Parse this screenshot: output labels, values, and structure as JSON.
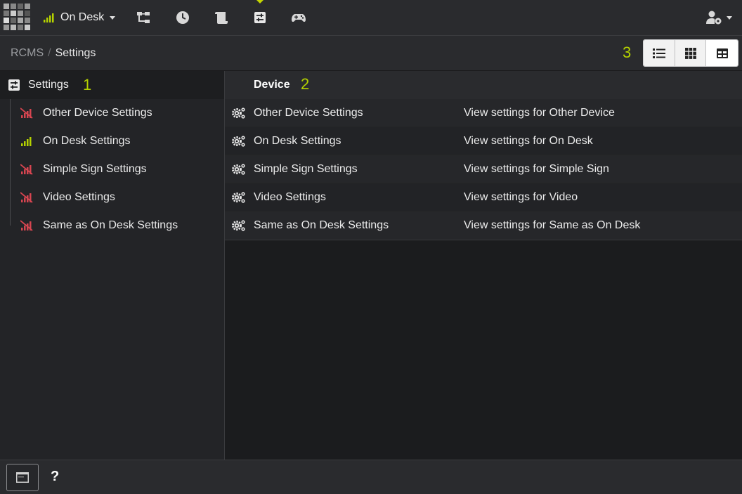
{
  "topbar": {
    "logo_icon": "app-grid-logo",
    "device_selector": {
      "label": "On Desk",
      "icon": "signal-bars-icon",
      "signal_color": "#b5d200"
    },
    "nav_icons": [
      "sitemap-icon",
      "clock-icon",
      "scroll-icon",
      "sliders-icon",
      "gamepad-icon"
    ],
    "active_nav": "sliders-icon",
    "user_menu_icon": "user-gear-icon"
  },
  "breadcrumb": {
    "root": "RCMS",
    "separator": "/",
    "current": "Settings"
  },
  "markers": {
    "sidebar": "1",
    "table": "2",
    "view": "3"
  },
  "view_toggle": {
    "options": [
      "list-view-icon",
      "grid-view-icon",
      "table-view-icon"
    ],
    "selected": "table-view-icon"
  },
  "sidebar": {
    "header": {
      "icon": "sliders-icon",
      "title": "Settings"
    },
    "items": [
      {
        "label": "Other Device Settings",
        "status": "no-signal",
        "color": "#d64550"
      },
      {
        "label": "On Desk Settings",
        "status": "signal",
        "color": "#b5d200"
      },
      {
        "label": "Simple Sign Settings",
        "status": "no-signal",
        "color": "#d64550"
      },
      {
        "label": "Video Settings",
        "status": "no-signal",
        "color": "#d64550"
      },
      {
        "label": "Same as On Desk Settings",
        "status": "no-signal",
        "color": "#d64550"
      }
    ]
  },
  "table": {
    "column_header": "Device",
    "rows": [
      {
        "name": "Other Device Settings",
        "description": "View settings for Other Device"
      },
      {
        "name": "On Desk Settings",
        "description": "View settings for On Desk"
      },
      {
        "name": "Simple Sign Settings",
        "description": "View settings for Simple Sign"
      },
      {
        "name": "Video Settings",
        "description": "View settings for Video"
      },
      {
        "name": "Same as On Desk Settings",
        "description": "View settings for Same as On Desk"
      }
    ]
  },
  "bottombar": {
    "console_icon": "console-window-icon",
    "help_label": "?"
  },
  "colors": {
    "accent": "#b5d200",
    "error": "#d64550"
  }
}
